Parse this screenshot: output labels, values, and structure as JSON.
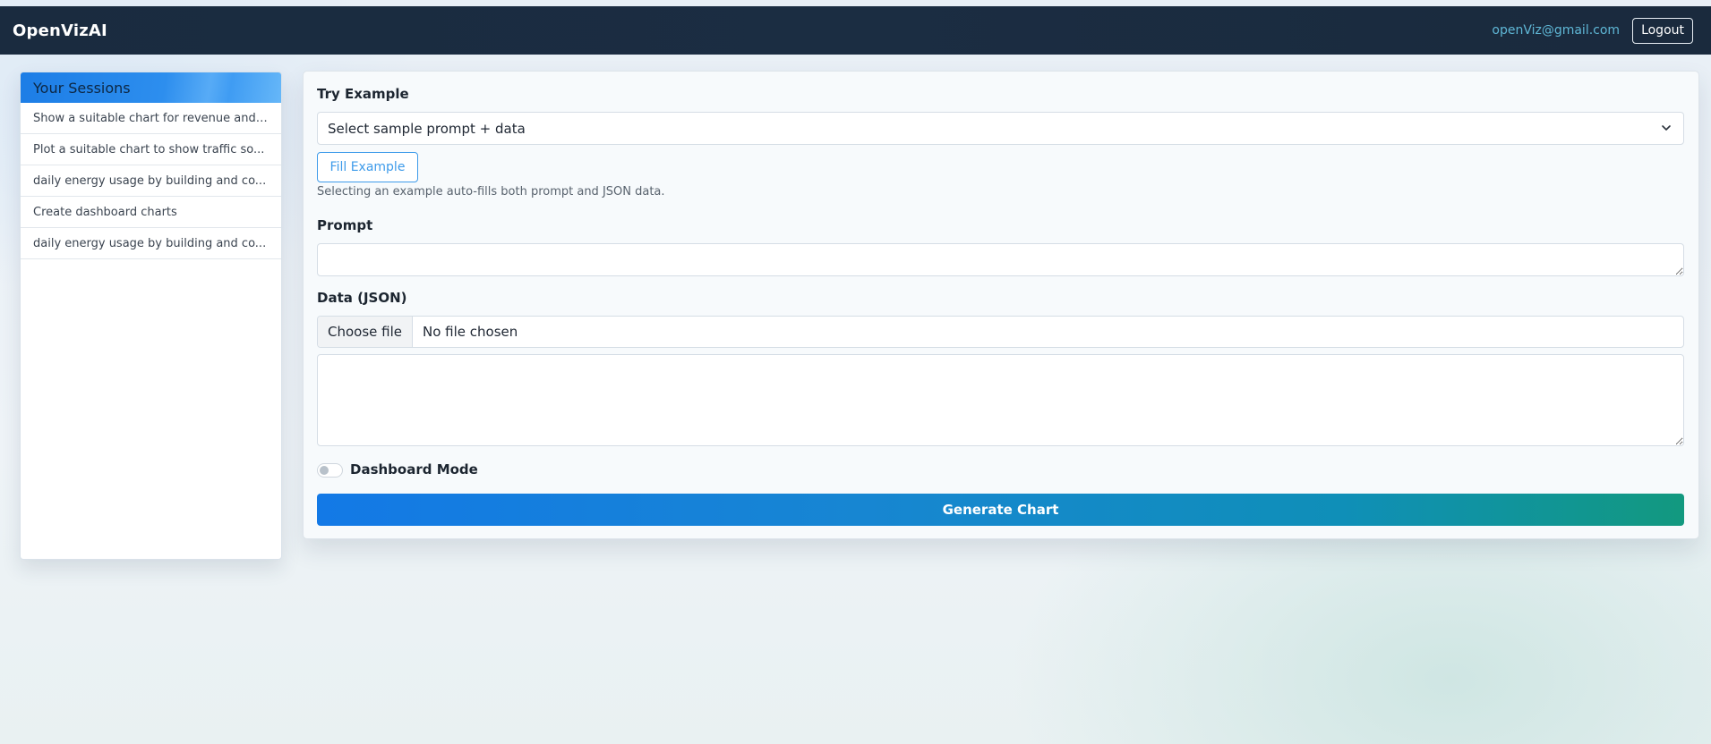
{
  "navbar": {
    "brand": "OpenVizAI",
    "user_email": "openViz@gmail.com",
    "logout_label": "Logout"
  },
  "sidebar": {
    "title": "Your Sessions",
    "items": [
      {
        "label": "Show a suitable chart for revenue and ..."
      },
      {
        "label": "Plot a suitable chart to show traffic so..."
      },
      {
        "label": "daily energy usage by building and co..."
      },
      {
        "label": "Create dashboard charts"
      },
      {
        "label": "daily energy usage by building and co..."
      }
    ]
  },
  "form": {
    "try_example_label": "Try Example",
    "example_select_value": "Select sample prompt + data",
    "fill_example_label": "Fill Example",
    "help_text": "Selecting an example auto-fills both prompt and JSON data.",
    "prompt_label": "Prompt",
    "prompt_value": "",
    "data_label": "Data (JSON)",
    "choose_file_label": "Choose file",
    "file_status": "No file chosen",
    "json_value": "",
    "dashboard_mode_label": "Dashboard Mode",
    "dashboard_mode_on": false,
    "generate_label": "Generate Chart"
  },
  "icons": {
    "select_chevron": "chevron-down-icon"
  },
  "colors": {
    "navbar_bg": "#1a2b3f",
    "accent_blue": "#1c7de6",
    "email_color": "#5fb7d6",
    "generate_gradient_start": "#1379e6",
    "generate_gradient_end": "#12997f"
  }
}
